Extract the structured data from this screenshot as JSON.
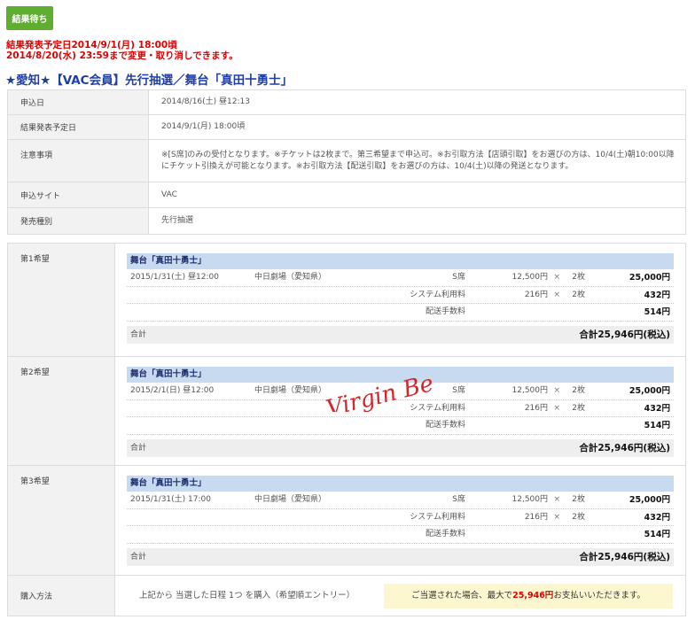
{
  "status_badge": "結果待ち",
  "notice": {
    "line1": "結果発表予定日2014/9/1(月) 18:00頃",
    "line2": "2014/8/20(水) 23:59まで変更・取り消しできます。"
  },
  "event_title": "★愛知★【VAC会員】先行抽選／舞台「真田十勇士」",
  "info_rows": [
    {
      "label": "申込日",
      "value": "2014/8/16(土) 昼12:13"
    },
    {
      "label": "結果発表予定日",
      "value": "2014/9/1(月) 18:00頃"
    },
    {
      "label": "注意事項",
      "value": "※[S席]のみの受付となります。※チケットは2枚まで。第三希望まで申込可。※お引取方法【店頭引取】をお選びの方は、10/4(土)朝10:00以降にチケット引換えが可能となります。※お引取方法【配送引取】をお選びの方は、10/4(土)以降の発送となります。"
    },
    {
      "label": "申込サイト",
      "value": "VAC"
    },
    {
      "label": "発売種別",
      "value": "先行抽選"
    }
  ],
  "choices": [
    {
      "label": "第1希望",
      "show": "舞台「真田十勇士」",
      "date": "2015/1/31(土) 昼12:00",
      "venue": "中日劇場（愛知県）",
      "seat": "S席",
      "price": "12,500円",
      "times": "×",
      "qty": "2枚",
      "subtotal": "25,000円",
      "system_fee_label": "システム利用料",
      "system_fee_price": "216円",
      "system_fee_qty": "2枚",
      "system_fee_subtotal": "432円",
      "delivery_fee_label": "配送手数料",
      "delivery_fee_subtotal": "514円",
      "total_label": "合計",
      "total_amount": "合計25,946円(税込)"
    },
    {
      "label": "第2希望",
      "show": "舞台「真田十勇士」",
      "date": "2015/2/1(日) 昼12:00",
      "venue": "中日劇場（愛知県）",
      "seat": "S席",
      "price": "12,500円",
      "times": "×",
      "qty": "2枚",
      "subtotal": "25,000円",
      "system_fee_label": "システム利用料",
      "system_fee_price": "216円",
      "system_fee_qty": "2枚",
      "system_fee_subtotal": "432円",
      "delivery_fee_label": "配送手数料",
      "delivery_fee_subtotal": "514円",
      "total_label": "合計",
      "total_amount": "合計25,946円(税込)"
    },
    {
      "label": "第3希望",
      "show": "舞台「真田十勇士」",
      "date": "2015/1/31(土) 17:00",
      "venue": "中日劇場（愛知県）",
      "seat": "S席",
      "price": "12,500円",
      "times": "×",
      "qty": "2枚",
      "subtotal": "25,000円",
      "system_fee_label": "システム利用料",
      "system_fee_price": "216円",
      "system_fee_qty": "2枚",
      "system_fee_subtotal": "432円",
      "delivery_fee_label": "配送手数料",
      "delivery_fee_subtotal": "514円",
      "total_label": "合計",
      "total_amount": "合計25,946円(税込)"
    }
  ],
  "purchase": {
    "label": "購入方法",
    "text": "上記から 当選した日程 1つ を購入（希望順エントリー）",
    "note_prefix": "ご当選された場合、最大で",
    "note_amount": "25,946円",
    "note_suffix": "お支払いいただきます。"
  },
  "watermark": "Virgin Beat",
  "colors": {
    "badge": "#5fae2f",
    "notice": "#e00000",
    "title": "#1f3ea8",
    "show_bar": "#c7daf0",
    "note_bg": "#fdf7d0"
  }
}
